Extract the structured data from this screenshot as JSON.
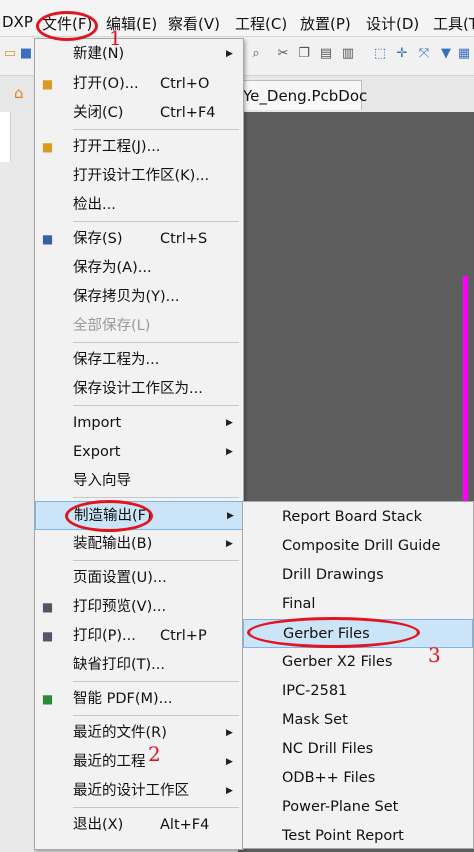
{
  "menubar": {
    "items": [
      {
        "label": "DXP"
      },
      {
        "label": "文件(F)"
      },
      {
        "label": "编辑(E)"
      },
      {
        "label": "察看(V)"
      },
      {
        "label": "工程(C)"
      },
      {
        "label": "放置(P)"
      },
      {
        "label": "设计(D)"
      },
      {
        "label": "工具(T"
      }
    ]
  },
  "document": {
    "tab_label": "Ye_Deng.PcbDoc"
  },
  "file_menu": {
    "items": [
      {
        "label": "新建(N)",
        "shortcut": "",
        "submenu": true,
        "icon": ""
      },
      {
        "label": "打开(O)...",
        "shortcut": "Ctrl+O",
        "submenu": false,
        "icon": "folder-open-icon"
      },
      {
        "label": "关闭(C)",
        "shortcut": "Ctrl+F4",
        "submenu": false,
        "icon": ""
      },
      {
        "label": "打开工程(J)...",
        "shortcut": "",
        "submenu": false,
        "icon": "open-project-icon"
      },
      {
        "label": "打开设计工作区(K)...",
        "shortcut": "",
        "submenu": false,
        "icon": ""
      },
      {
        "label": "检出...",
        "shortcut": "",
        "submenu": false,
        "icon": ""
      },
      {
        "label": "保存(S)",
        "shortcut": "Ctrl+S",
        "submenu": false,
        "icon": "save-icon"
      },
      {
        "label": "保存为(A)...",
        "shortcut": "",
        "submenu": false,
        "icon": ""
      },
      {
        "label": "保存拷贝为(Y)...",
        "shortcut": "",
        "submenu": false,
        "icon": ""
      },
      {
        "label": "全部保存(L)",
        "shortcut": "",
        "submenu": false,
        "icon": "",
        "disabled": true
      },
      {
        "label": "保存工程为...",
        "shortcut": "",
        "submenu": false,
        "icon": ""
      },
      {
        "label": "保存设计工作区为...",
        "shortcut": "",
        "submenu": false,
        "icon": ""
      },
      {
        "label": "Import",
        "shortcut": "",
        "submenu": true,
        "icon": ""
      },
      {
        "label": "Export",
        "shortcut": "",
        "submenu": true,
        "icon": ""
      },
      {
        "label": "导入向导",
        "shortcut": "",
        "submenu": false,
        "icon": ""
      },
      {
        "label": "制造输出(F)",
        "shortcut": "",
        "submenu": true,
        "icon": "",
        "highlighted": true
      },
      {
        "label": "装配输出(B)",
        "shortcut": "",
        "submenu": true,
        "icon": ""
      },
      {
        "label": "页面设置(U)...",
        "shortcut": "",
        "submenu": false,
        "icon": ""
      },
      {
        "label": "打印预览(V)...",
        "shortcut": "",
        "submenu": false,
        "icon": "print-preview-icon"
      },
      {
        "label": "打印(P)...",
        "shortcut": "Ctrl+P",
        "submenu": false,
        "icon": "print-icon"
      },
      {
        "label": "缺省打印(T)...",
        "shortcut": "",
        "submenu": false,
        "icon": ""
      },
      {
        "label": "智能 PDF(M)...",
        "shortcut": "",
        "submenu": false,
        "icon": "smart-pdf-icon"
      },
      {
        "label": "最近的文件(R)",
        "shortcut": "",
        "submenu": true,
        "icon": ""
      },
      {
        "label": "最近的工程",
        "shortcut": "",
        "submenu": true,
        "icon": ""
      },
      {
        "label": "最近的设计工作区",
        "shortcut": "",
        "submenu": true,
        "icon": ""
      },
      {
        "label": "退出(X)",
        "shortcut": "Alt+F4",
        "submenu": false,
        "icon": ""
      }
    ]
  },
  "fab_submenu": {
    "items": [
      {
        "label": "Report Board Stack"
      },
      {
        "label": "Composite Drill Guide"
      },
      {
        "label": "Drill Drawings"
      },
      {
        "label": "Final"
      },
      {
        "label": "Gerber Files",
        "highlighted": true
      },
      {
        "label": "Gerber X2 Files"
      },
      {
        "label": "IPC-2581"
      },
      {
        "label": "Mask Set"
      },
      {
        "label": "NC Drill Files"
      },
      {
        "label": "ODB++ Files"
      },
      {
        "label": "Power-Plane Set"
      },
      {
        "label": "Test Point Report"
      }
    ]
  },
  "annotations": {
    "step1": "1",
    "step2": "2",
    "step3": "3",
    "color": "#e0151f"
  },
  "colors": {
    "highlight": "#cce4f7",
    "highlight_border": "#7eb4ea",
    "canvas": "#5e5e5e",
    "board_edge": "#ff00ff"
  }
}
